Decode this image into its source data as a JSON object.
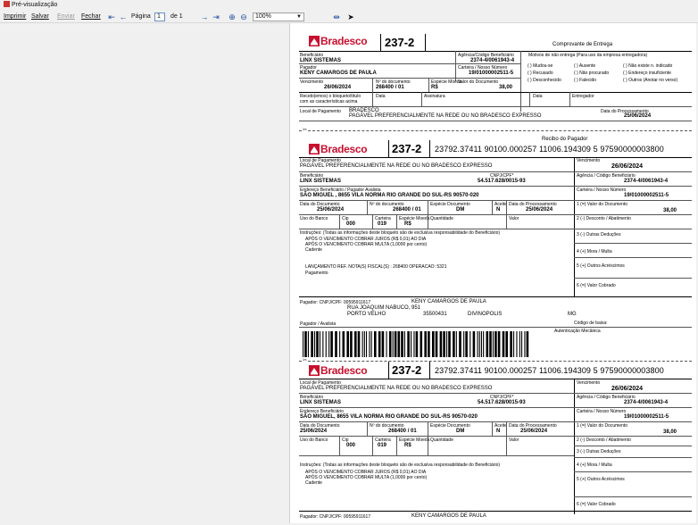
{
  "window": {
    "title": "Pré-visualização"
  },
  "toolbar": {
    "print_label": "Imprimir",
    "save_label": "Salvar",
    "send_label": "Enviar",
    "close_label": "Fechar",
    "page_label": "Página",
    "page_value": "1",
    "of_label": "de 1",
    "zoom_value": "100%"
  },
  "receipt": {
    "bank_name": "Bradesco",
    "bank_code": "237-2",
    "title": "Comprovante de Entrega",
    "beneficiario_label": "Beneficiário",
    "beneficiario": "LINX SISTEMAS",
    "agencia_label": "Agência/Código Beneficiário",
    "agencia": "2374-4/0061943-4",
    "pagador_label": "Pagador",
    "pagador": "KENY CAMARGOS DE PAULA",
    "carteira_label": "Carteira / Nosso Número",
    "nosso_numero": "19/01000002511-5",
    "vencimento_label": "Vencimento",
    "vencimento": "26/06/2024",
    "documento_label": "Nº do documento",
    "documento": "268400 / 01",
    "especie_label": "Espécie Moeda",
    "especie": "R$",
    "valor_label": "Valor do Documento",
    "valor": "38,00",
    "motivos_label": "Motivos de não entrega (Para uso da empresa entregadora)",
    "motivos": [
      "( ) Mudou-se",
      "( ) Ausente",
      "( ) Não existe n. indicado",
      "( ) Recusado",
      "( ) Não procurado",
      "( ) Endereço insuficiente",
      "( ) Desconhecido",
      "( ) Falecido",
      "( ) Outros (Anotar no verso)"
    ],
    "recebi_label": "Recebi(emos) o bloqueto/título com as características acima",
    "data_label": "Data",
    "assinatura_label": "Assinatura",
    "entregador_label": "Entregador",
    "local_label": "Local de Pagamento",
    "local_bank": "BRADESCO",
    "local_text": "PAGÁVEL PREFERENCIALMENTE NA REDE  OU NO BRADESCO EXPRESSO",
    "data_processamento_label": "Data do Processamento",
    "data_processamento": "25/06/2024"
  },
  "cut_label": "Recibo do Pagador",
  "slip": {
    "bank_name": "Bradesco",
    "bank_code": "237-2",
    "linha_digitavel": "23792.37411  90100.000257  11006.194309  5  97590000003800",
    "local_label": "Local de Pagamento",
    "local_text": "PAGÁVEL PREFERENCIALMENTE NA REDE  OU NO BRADESCO EXPRESSO",
    "vencimento_label": "Vencimento",
    "vencimento": "26/06/2024",
    "beneficiario_label": "Beneficiário",
    "beneficiario": "LINX SISTEMAS",
    "cnpj_label": "CNPJ/CPF*",
    "cnpj": "54.517.628/0015-93",
    "agencia_label": "Agência / Código Beneficiário",
    "agencia": "2374-4/0061943-4",
    "endereco_label": "Endereço Beneficiário / Pagador Avalista",
    "endereco": "SÃO MIGUEL , 8655 VILA NORMA RIO GRANDE DO SUL-RS 90570-020",
    "carteira_label": "Carteira / Nosso Número",
    "nosso_numero": "19/01000002511-5",
    "data_documento_label": "Data do Documento",
    "data_documento": "25/06/2024",
    "documento_label": "Nº do documento",
    "documento": "268400  /  01",
    "especie_doc_label": "Espécie Documento",
    "especie_doc": "DM",
    "aceite_label": "Aceite",
    "aceite": "N",
    "data_proc_label": "Data do Processamento",
    "data_proc": "25/06/2024",
    "valor_doc_label": "1 (=) Valor do Documento",
    "valor_doc": "38,00",
    "uso_banco_label": "Uso do Banco",
    "cip_label": "Cip",
    "cip": "000",
    "carteira2_label": "Carteira",
    "carteira2": "019",
    "especie_moeda_label": "Espécie Moeda",
    "especie_moeda": "R$",
    "quantidade_label": "Quantidade",
    "valor_label": "Valor",
    "desconto_label": "2 (-) Desconto / Abatimento",
    "deducoes_label": "3 (-) Outras Deduções",
    "mora_label": "4 (+) Mora / Multa",
    "acrescimos_label": "5 (+) Outros Acréscimos",
    "cobrado_label": "6 (=) Valor Cobrado",
    "instrucoes_label": "Instruções: (Todas as informações deste bloqueto são de exclusiva responsabilidade do Beneficiário)",
    "instrucoes": [
      "APÓS O VENCIMENTO COBRAR JUROS (R$ 0,01) AO DIA",
      "APÓS O VENCIMENTO COBRAR MULTA (1,0000 por cento)",
      "Cadente"
    ],
    "lancamento": "LANÇAMENTO REF. NOTA(S) FISCAL(S) :  268400 OPERACAO: 5321",
    "pagamento": "Pagamento",
    "pagador_label": "Pagador: CNPJ/CPF: 00595911617",
    "pagador_nome": "KENY CAMARGOS DE PAULA",
    "pagador_endereco": "RUA JOAQUIM NABUCO, 951",
    "pagador_bairro": "PORTO VELHO",
    "pagador_cep": "35500431",
    "pagador_cidade": "DIVINOPOLIS",
    "pagador_uf": "MG",
    "avalista_label": "Pagador / Avalista",
    "codigo_baixa_label": "Código de baixa:",
    "autenticacao_label": "Autenticação Mecânica"
  },
  "slip2": {
    "bank_name": "Bradesco",
    "bank_code": "237-2",
    "linha_digitavel": "23792.37411  90100.000257  11006.194309  5  97590000003800",
    "local_label": "Local de Pagamento",
    "local_text": "PAGÁVEL PREFERENCIALMENTE NA REDE  OU NO BRADESCO EXPRESSO",
    "vencimento_label": "Vencimento",
    "vencimento": "26/06/2024",
    "beneficiario_label": "Beneficiário",
    "beneficiario": "LINX SISTEMAS",
    "cnpj_label": "CNPJ/CPF*",
    "cnpj": "54.517.628/0015-93",
    "agencia_label": "Agência / Código Beneficiário",
    "agencia": "2374-4/0061943-4",
    "endereco_label": "Endereço Beneficiário",
    "endereco": "SÃO MIGUEL, 8655 VILA NORMA RIO GRANDE DO SUL-RS 90570-020",
    "carteira_label": "Carteira / Nosso Número",
    "nosso_numero": "19/01000002511-5",
    "data_documento_label": "Data do Documento",
    "data_documento": "25/06/2024",
    "documento_label": "Nº do documento",
    "documento": "268400  /  01",
    "especie_doc_label": "Espécie Documento",
    "especie_doc": "DM",
    "aceite_label": "Aceite",
    "aceite": "N",
    "data_proc_label": "Data do Processamento",
    "data_proc": "25/06/2024",
    "valor_doc_label": "1 (=) Valor do Documento",
    "valor_doc": "38,00",
    "uso_banco_label": "Uso do Banco",
    "cip_label": "Cip",
    "cip": "000",
    "carteira2_label": "Carteira",
    "carteira2": "019",
    "especie_moeda_label": "Espécie Moeda",
    "especie_moeda": "R$",
    "quantidade_label": "Quantidade",
    "valor_label": "Valor",
    "desconto_label": "2 (-) Desconto / Abatimento",
    "deducoes_label": "3 (-) Outras Deduções",
    "mora_label": "4 (+) Mora / Multa",
    "acrescimos_label": "5 (+) Outros Acréscimos",
    "cobrado_label": "6 (=) Valor Cobrado",
    "instrucoes_label": "Instruções: (Todas as informações deste bloqueto são de exclusiva responsabilidade do Beneficiário)",
    "instrucoes": [
      "APÓS O VENCIMENTO COBRAR JUROS (R$ 0,01) AO DIA",
      "APÓS O VENCIMENTO COBRAR MULTA (1,0000 por cento)",
      "Cadente"
    ],
    "pagador_label": "Pagador: CNPJ/CPF: 00595911617",
    "pagador_nome": "KENY CAMARGOS DE PAULA"
  }
}
